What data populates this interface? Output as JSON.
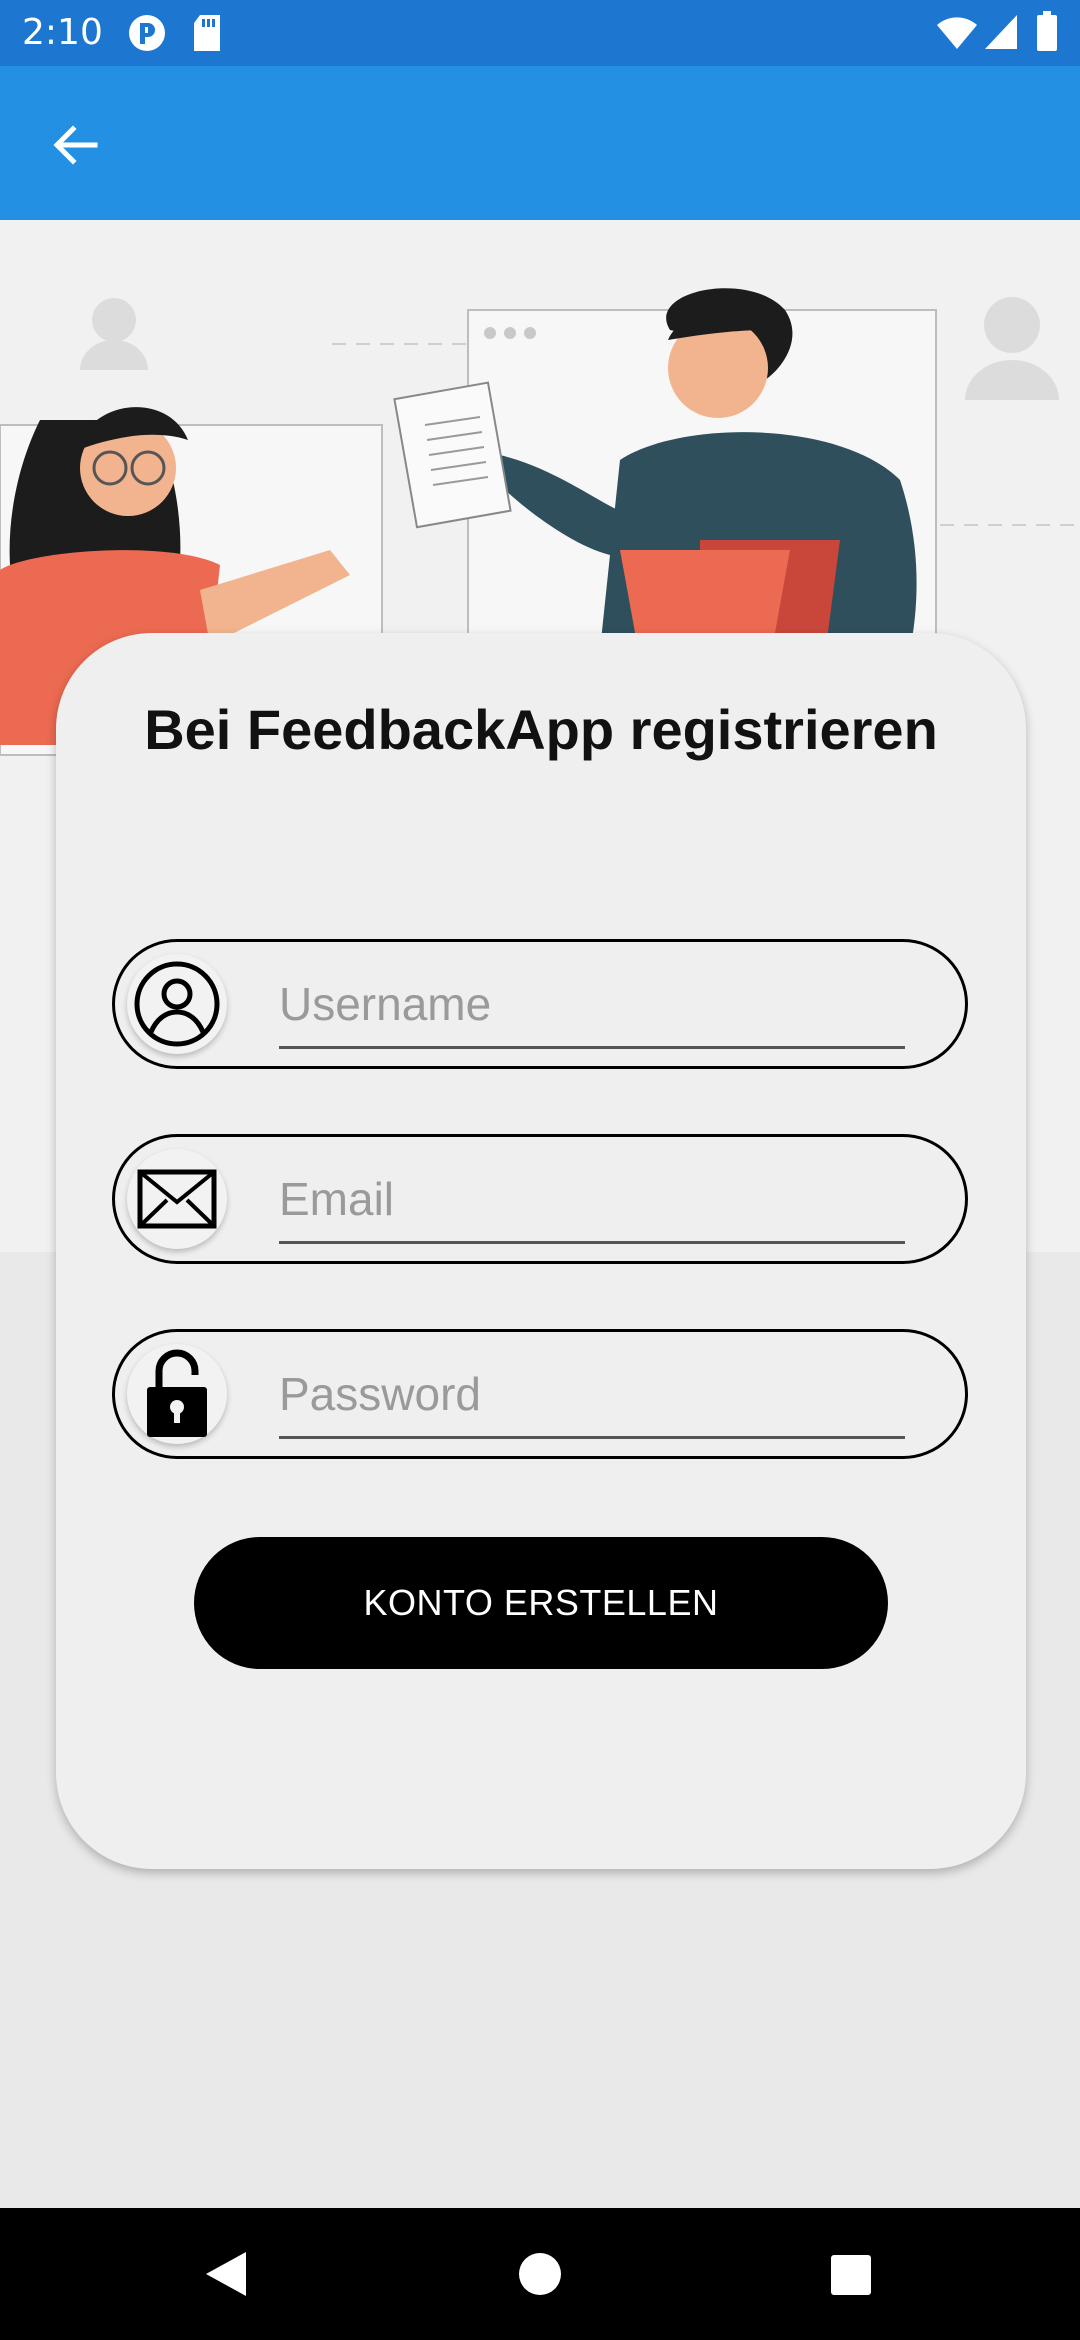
{
  "status_bar": {
    "time": "2:10",
    "left_icons": [
      "app-notification-icon",
      "sd-card-icon"
    ],
    "right_icons": [
      "wifi-icon",
      "cell-signal-icon",
      "battery-icon"
    ],
    "color": "#1d76d0"
  },
  "app_bar": {
    "back_icon": "arrow-back-icon",
    "color": "#2490e3"
  },
  "hero": {
    "illustration": "two-people-collaborating-illustration"
  },
  "form": {
    "title": "Bei FeedbackApp registrieren",
    "fields": [
      {
        "icon": "user-circle-icon",
        "placeholder": "Username",
        "value": ""
      },
      {
        "icon": "envelope-icon",
        "placeholder": "Email",
        "value": ""
      },
      {
        "icon": "padlock-icon",
        "placeholder": "Password",
        "value": ""
      }
    ],
    "submit_label": "KONTO ERSTELLEN"
  },
  "nav_bar": {
    "buttons": [
      "back-triangle-icon",
      "home-circle-icon",
      "recents-square-icon"
    ]
  }
}
